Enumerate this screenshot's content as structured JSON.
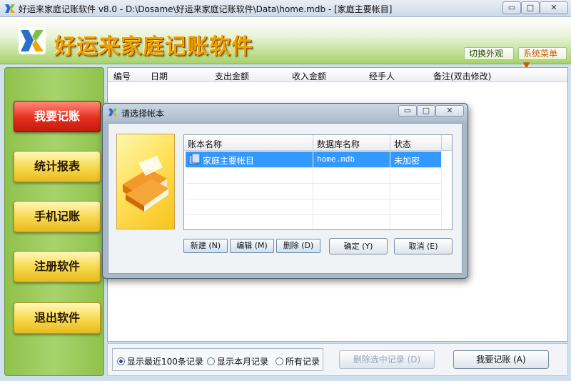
{
  "window": {
    "title": "好运来家庭记账软件 v8.0 - D:\\Dosame\\好运来家庭记账软件\\Data\\home.mdb - [家庭主要帐目]",
    "min_glyph": "▭",
    "max_glyph": "□",
    "close_glyph": "✕"
  },
  "header": {
    "brand": "好运来家庭记账软件",
    "skin_button": "切换外观",
    "system_menu_button": "系统菜单▼"
  },
  "sidebar": {
    "items": [
      {
        "label": "我要记账",
        "active": true
      },
      {
        "label": "统计报表",
        "active": false
      },
      {
        "label": "手机记账",
        "active": false
      },
      {
        "label": "注册软件",
        "active": false
      },
      {
        "label": "退出软件",
        "active": false
      }
    ]
  },
  "grid": {
    "columns": [
      "编号",
      "日期",
      "支出金额",
      "收入金额",
      "经手人",
      "备注(双击修改)"
    ]
  },
  "bottom": {
    "radio_recent": "显示最近100条记录",
    "radio_month": "显示本月记录",
    "radio_all": "所有记录",
    "selected_radio": "radio_recent",
    "delete_button": "删除选中记录 (D)",
    "add_button": "我要记账 (A)"
  },
  "dialog": {
    "title": "请选择帐本",
    "columns": [
      "账本名称",
      "数据库名称",
      "状态"
    ],
    "rows": [
      {
        "name": "家庭主要帐目",
        "db": "home.mdb",
        "status": "未加密"
      }
    ],
    "new_button": "新建 (N)",
    "edit_button": "编辑 (M)",
    "delete_button": "删除 (D)",
    "ok_button": "确定 (Y)",
    "cancel_button": "取消 (E)"
  },
  "colors": {
    "accent_green": "#8fc24c",
    "active_red": "#e63020",
    "nav_yellow": "#f6d84b",
    "selection_blue": "#3399ff"
  }
}
